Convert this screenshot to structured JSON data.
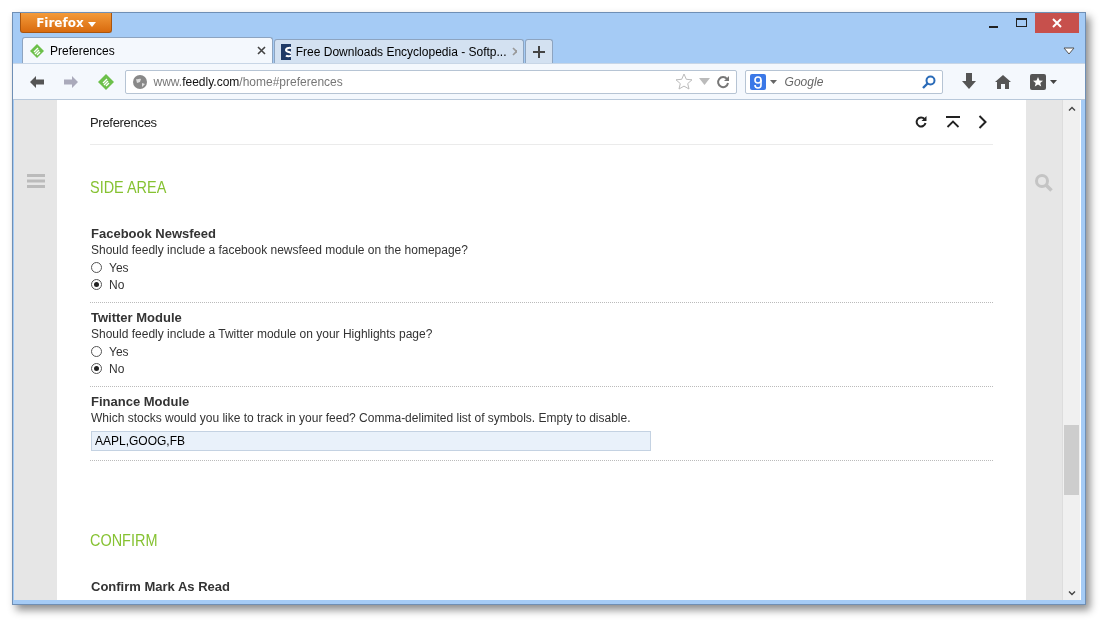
{
  "app_button": {
    "label": "Firefox"
  },
  "tabs": [
    {
      "title": "Preferences",
      "selected": true
    },
    {
      "title": "Free Downloads Encyclopedia - Softp...",
      "selected": false
    }
  ],
  "address_bar": {
    "prefix": "www.",
    "domain": "feedly.com",
    "path": "/home#preferences"
  },
  "search": {
    "placeholder": "Google"
  },
  "page": {
    "title": "Preferences",
    "sections": [
      {
        "title": "SIDE AREA",
        "settings": [
          {
            "kind": "radio",
            "title": "Facebook Newsfeed",
            "description": "Should feedly include a facebook newsfeed module on the homepage?",
            "options": [
              {
                "label": "Yes",
                "selected": false
              },
              {
                "label": "No",
                "selected": true
              }
            ]
          },
          {
            "kind": "radio",
            "title": "Twitter Module",
            "description": "Should feedly include a Twitter module on your Highlights page?",
            "options": [
              {
                "label": "Yes",
                "selected": false
              },
              {
                "label": "No",
                "selected": true
              }
            ]
          },
          {
            "kind": "text",
            "title": "Finance Module",
            "description": "Which stocks would you like to track in your feed? Comma-delimited list of symbols. Empty to disable.",
            "value": "AAPL,GOOG,FB"
          }
        ]
      },
      {
        "title": "CONFIRM",
        "settings": [
          {
            "kind": "plain",
            "title": "Confirm Mark As Read"
          }
        ]
      }
    ]
  }
}
